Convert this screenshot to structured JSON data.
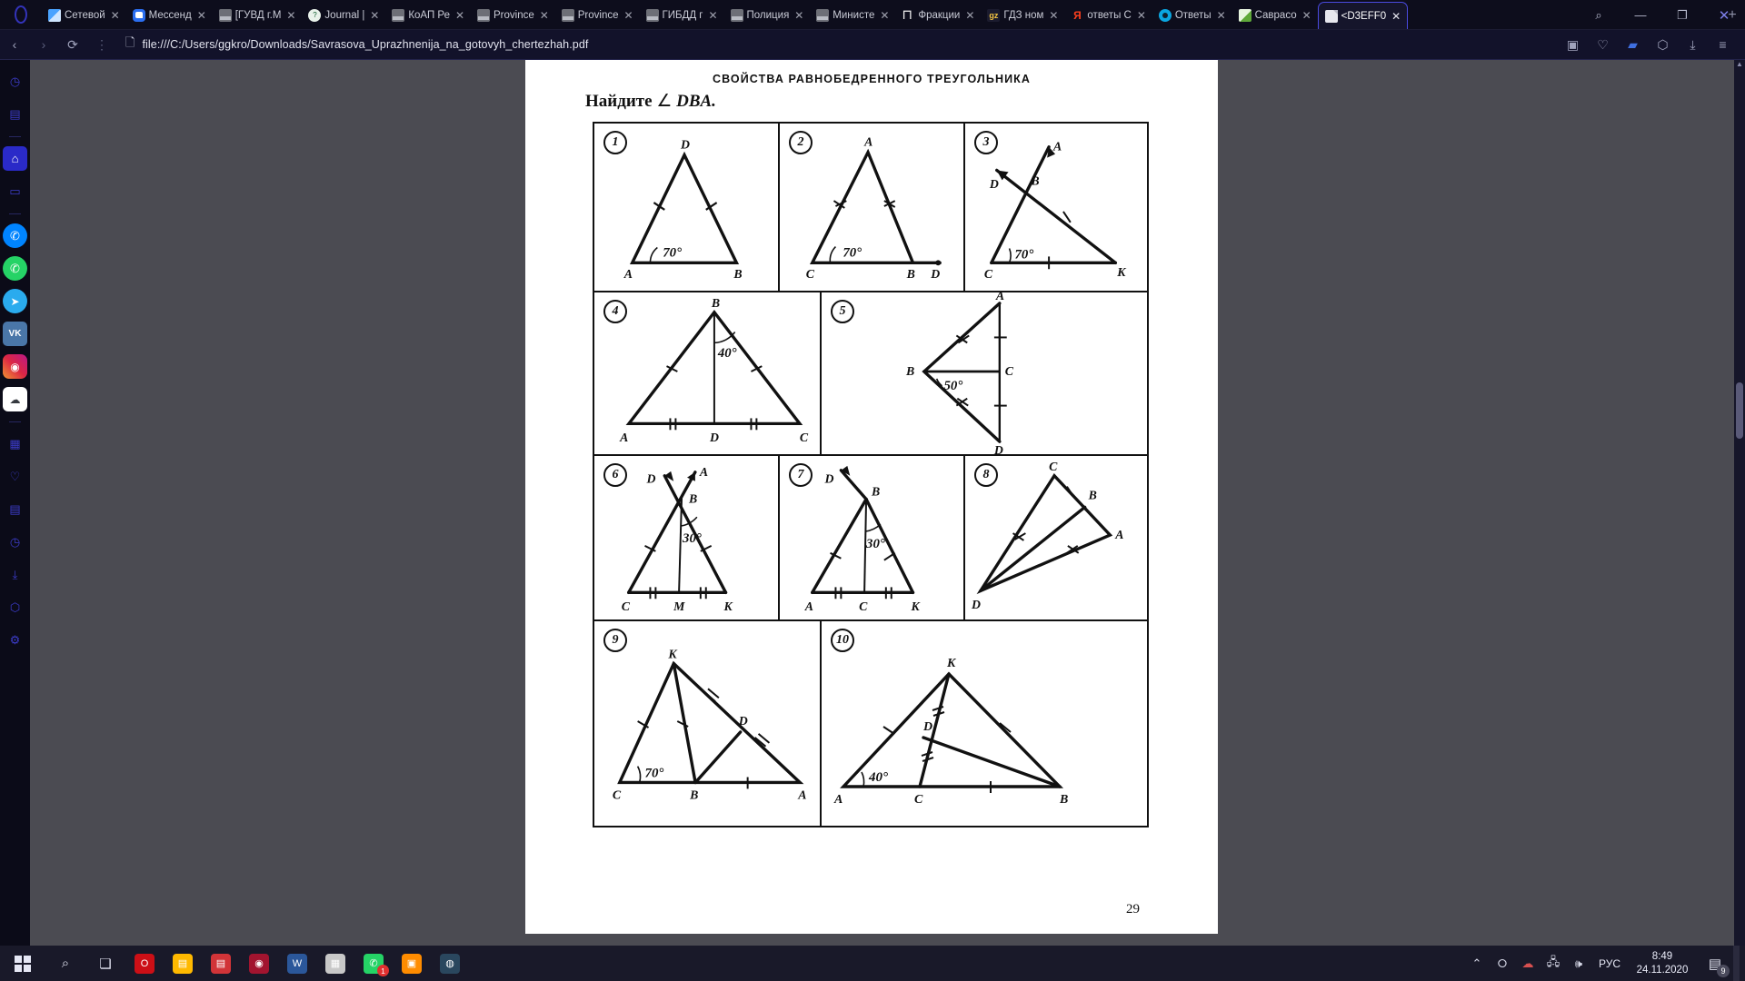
{
  "browser": {
    "tabs": [
      {
        "title": "Сетевой",
        "icon": "windows-icon",
        "favicon_class": "fv-win",
        "active": false
      },
      {
        "title": "Мессенд",
        "icon": "messenger-icon",
        "favicon_class": "fv-msg",
        "active": false
      },
      {
        "title": "[ГУВД г.М",
        "icon": "gov-icon",
        "favicon_class": "fv-gov",
        "active": false
      },
      {
        "title": "Journal |",
        "icon": "journal-icon",
        "favicon_class": "fv-journal",
        "active": false
      },
      {
        "title": "КоАП Ре",
        "icon": "gov-icon",
        "favicon_class": "fv-gov",
        "active": false
      },
      {
        "title": "Province",
        "icon": "gov-icon",
        "favicon_class": "fv-gov",
        "active": false
      },
      {
        "title": "Province",
        "icon": "gov-icon",
        "favicon_class": "fv-gov",
        "active": false
      },
      {
        "title": "ГИБДД г",
        "icon": "gov-icon",
        "favicon_class": "fv-gov",
        "active": false
      },
      {
        "title": "Полиция",
        "icon": "gov-icon",
        "favicon_class": "fv-gov",
        "active": false
      },
      {
        "title": "Министе",
        "icon": "gov-icon",
        "favicon_class": "fv-gov",
        "active": false
      },
      {
        "title": "Фракции",
        "icon": "p-letter-icon",
        "favicon_class": "fv-p",
        "active": false
      },
      {
        "title": "ГДЗ ном",
        "icon": "gdz-icon",
        "favicon_class": "fv-gdz",
        "active": false
      },
      {
        "title": "ответы С",
        "icon": "yandex-icon",
        "favicon_class": "fv-ya",
        "active": false
      },
      {
        "title": "Ответы ",
        "icon": "mail-ru-icon",
        "favicon_class": "fv-mail",
        "active": false
      },
      {
        "title": "Саврасо",
        "icon": "document-green-icon",
        "favicon_class": "fv-doc-green",
        "active": false
      },
      {
        "title": "<D3EFF0",
        "icon": "pdf-file-icon",
        "favicon_class": "fv-pdf",
        "active": true
      }
    ],
    "tab_close_glyph": "✕",
    "new_tab_glyph": "+",
    "window_controls": {
      "search": "search-icon",
      "minimize": "minimize-icon",
      "restore": "restore-icon",
      "close": "close-icon"
    },
    "toolbar": {
      "back": "back-arrow-icon",
      "forward": "forward-arrow-icon",
      "reload": "reload-icon",
      "menu_dots": "vertical-dots-icon",
      "page_icon": "page-document-icon",
      "url": "file:///C:/Users/ggkro/Downloads/Savrasova_Uprazhnenija_na_gotovyh_chertezhah.pdf",
      "url_placeholder": "Search or enter address",
      "right_icons": [
        {
          "name": "screenshot-camera-icon",
          "glyph": "▣"
        },
        {
          "name": "favorites-heart-icon",
          "glyph": "♡"
        },
        {
          "name": "shopping-cart-icon",
          "glyph": "▰"
        },
        {
          "name": "3d-box-icon",
          "glyph": "⬡"
        },
        {
          "name": "downloads-icon",
          "glyph": "⤓"
        },
        {
          "name": "settings-sliders-icon",
          "glyph": "≡"
        }
      ]
    },
    "sidebar_rail": [
      {
        "name": "compass-icon",
        "glyph": "◷",
        "style": ""
      },
      {
        "name": "briefcase-icon",
        "glyph": "▤",
        "style": ""
      },
      {
        "name": "separator",
        "glyph": "",
        "style": "sep"
      },
      {
        "name": "home-icon",
        "glyph": "⌂",
        "style": "active"
      },
      {
        "name": "games-icon",
        "glyph": "▭",
        "style": ""
      },
      {
        "name": "separator",
        "glyph": "",
        "style": "sep"
      },
      {
        "name": "messenger-icon",
        "glyph": "✆",
        "style": "clr-messenger"
      },
      {
        "name": "whatsapp-icon",
        "glyph": "✆",
        "style": "clr-whatsapp"
      },
      {
        "name": "telegram-icon",
        "glyph": "➤",
        "style": "clr-telegram"
      },
      {
        "name": "vk-icon",
        "glyph": "VK",
        "style": "clr-vk"
      },
      {
        "name": "instagram-icon",
        "glyph": "◉",
        "style": "clr-instagram"
      },
      {
        "name": "discord-icon",
        "glyph": "☁",
        "style": "clr-discord"
      },
      {
        "name": "separator",
        "glyph": "",
        "style": "sep"
      },
      {
        "name": "speed-dial-icon",
        "glyph": "▦",
        "style": ""
      },
      {
        "name": "bookmarks-heart-icon",
        "glyph": "♡",
        "style": ""
      },
      {
        "name": "news-icon",
        "glyph": "▤",
        "style": ""
      },
      {
        "name": "history-clock-icon",
        "glyph": "◷",
        "style": ""
      },
      {
        "name": "downloads-icon",
        "glyph": "⤓",
        "style": ""
      },
      {
        "name": "extensions-box-icon",
        "glyph": "⬡",
        "style": ""
      },
      {
        "name": "settings-gear-icon",
        "glyph": "⚙",
        "style": ""
      }
    ],
    "scrollbar": {
      "up_glyph": "▲",
      "down_glyph": "▼"
    }
  },
  "document": {
    "title": "СВОЙСТВА РАВНОБЕДРЕННОГО ТРЕУГОЛЬНИКА",
    "instruction_prefix": "Найдите",
    "instruction_angle_symbol": "∠",
    "instruction_label": "DBA.",
    "page_number": "29",
    "problems": [
      {
        "n": "1",
        "labels": [
          "D",
          "A",
          "B"
        ],
        "angle": "70°"
      },
      {
        "n": "2",
        "labels": [
          "A",
          "C",
          "B",
          "D"
        ],
        "angle": "70°"
      },
      {
        "n": "3",
        "labels": [
          "A",
          "D",
          "B",
          "C",
          "K"
        ],
        "angle": "70°"
      },
      {
        "n": "4",
        "labels": [
          "B",
          "A",
          "D",
          "C"
        ],
        "angle": "40°"
      },
      {
        "n": "5",
        "labels": [
          "A",
          "B",
          "C",
          "D"
        ],
        "angle": "50°"
      },
      {
        "n": "6",
        "labels": [
          "A",
          "D",
          "B",
          "C",
          "M",
          "K"
        ],
        "angle": "30°"
      },
      {
        "n": "7",
        "labels": [
          "D",
          "B",
          "A",
          "C",
          "K"
        ],
        "angle": "30°"
      },
      {
        "n": "8",
        "labels": [
          "C",
          "B",
          "A",
          "D"
        ],
        "angle": ""
      },
      {
        "n": "9",
        "labels": [
          "K",
          "D",
          "C",
          "B",
          "A"
        ],
        "angle": "70°"
      },
      {
        "n": "10",
        "labels": [
          "K",
          "D",
          "A",
          "C",
          "B"
        ],
        "angle": "40°"
      }
    ]
  },
  "taskbar": {
    "start": "windows-start-icon",
    "search": "search-icon",
    "taskview": "task-view-icon",
    "apps": [
      {
        "name": "opera-icon",
        "glyph": "O",
        "color": "#cc0f16",
        "badge": ""
      },
      {
        "name": "file-explorer-icon",
        "glyph": "▤",
        "color": "#ffb900",
        "badge": ""
      },
      {
        "name": "store-icon",
        "glyph": "▤",
        "color": "#d13438",
        "badge": ""
      },
      {
        "name": "browser-icon",
        "glyph": "◉",
        "color": "#a2142f",
        "badge": ""
      },
      {
        "name": "word-icon",
        "glyph": "W",
        "color": "#2b579a",
        "badge": ""
      },
      {
        "name": "paint-icon",
        "glyph": "▦",
        "color": "#c8c8c8",
        "badge": ""
      },
      {
        "name": "whatsapp-icon",
        "glyph": "✆",
        "color": "#25d366",
        "badge": "1"
      },
      {
        "name": "photos-icon",
        "glyph": "▣",
        "color": "#ff8c00",
        "badge": ""
      },
      {
        "name": "steam-icon",
        "glyph": "◍",
        "color": "#2a475e",
        "badge": ""
      }
    ],
    "tray": {
      "chevron": "show-hidden-icons-chevron",
      "microphone": "microphone-icon",
      "cloud_error": "cloud-error-icon",
      "network": "network-icon",
      "volume": "volume-icon",
      "language": "РУС",
      "time": "8:49",
      "date": "24.11.2020",
      "notifications_icon": "notifications-icon",
      "notifications_count": "9"
    }
  }
}
